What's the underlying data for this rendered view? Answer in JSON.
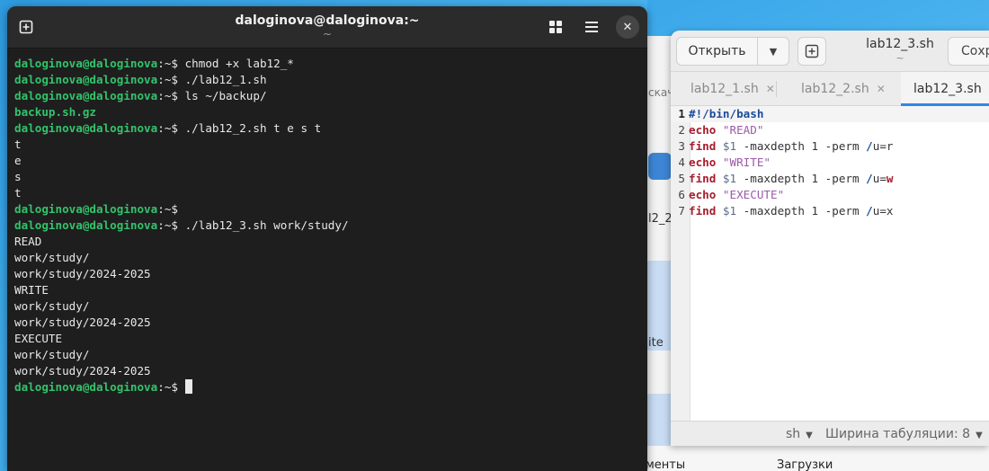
{
  "terminal": {
    "title": "daloginova@daloginova:~",
    "subtitle": "~",
    "close_label": "✕",
    "lines": [
      {
        "user": "daloginova@daloginova",
        "path": ":~$",
        "cmd": " chmod +x lab12_*"
      },
      {
        "user": "daloginova@daloginova",
        "path": ":~$",
        "cmd": " ./lab12_1.sh"
      },
      {
        "user": "daloginova@daloginova",
        "path": ":~$",
        "cmd": " ls ~/backup/"
      },
      {
        "out": "backup.sh.gz",
        "green": true
      },
      {
        "user": "daloginova@daloginova",
        "path": ":~$",
        "cmd": " ./lab12_2.sh t e s t"
      },
      {
        "out": "t"
      },
      {
        "out": "e"
      },
      {
        "out": "s"
      },
      {
        "out": "t"
      },
      {
        "user": "daloginova@daloginova",
        "path": ":~$",
        "cmd": ""
      },
      {
        "user": "daloginova@daloginova",
        "path": ":~$",
        "cmd": " ./lab12_3.sh work/study/"
      },
      {
        "out": "READ"
      },
      {
        "out": "work/study/"
      },
      {
        "out": "work/study/2024-2025"
      },
      {
        "out": "WRITE"
      },
      {
        "out": "work/study/"
      },
      {
        "out": "work/study/2024-2025"
      },
      {
        "out": "EXECUTE"
      },
      {
        "out": "work/study/"
      },
      {
        "out": "work/study/2024-2025"
      }
    ],
    "prompt_user": "daloginova@daloginova",
    "prompt_path": ":~$"
  },
  "editor": {
    "open_label": "Открыть",
    "title": "lab12_3.sh",
    "subtitle": "~",
    "save_label": "Сохр",
    "tabs": [
      {
        "label": "lab12_1.sh",
        "close": "✕"
      },
      {
        "label": "lab12_2.sh",
        "close": "✕"
      },
      {
        "label": "lab12_3.sh",
        "close": "✕"
      }
    ],
    "code": {
      "l1": {
        "num": "1",
        "a": "#!/bin/bash"
      },
      "l2": {
        "num": "2",
        "cmd": "echo",
        "str": " \"READ\""
      },
      "l3": {
        "num": "3",
        "cmd": "find",
        "var": " $1",
        "txt": " -maxdepth 1 -perm ",
        "op": "/",
        "tail": "u=r"
      },
      "l4": {
        "num": "4",
        "cmd": "echo",
        "str": " \"WRITE\""
      },
      "l5": {
        "num": "5",
        "cmd": "find",
        "var": " $1",
        "txt": " -maxdepth 1 -perm ",
        "op": "/",
        "tail": "u=",
        "w": "w"
      },
      "l6": {
        "num": "6",
        "cmd": "echo",
        "str": " \"EXECUTE\""
      },
      "l7": {
        "num": "7",
        "cmd": "find",
        "var": " $1",
        "txt": " -maxdepth 1 -perm ",
        "op": "/",
        "tail": "u=x"
      }
    },
    "status_lang": "sh",
    "status_tab": "Ширина табуляции: 8"
  },
  "background": {
    "partial_text_1": "ite",
    "partial_text_2": "l2_2.",
    "partial_text_3": "скач",
    "bottom_left": "менты",
    "bottom_right": "Загрузки"
  }
}
